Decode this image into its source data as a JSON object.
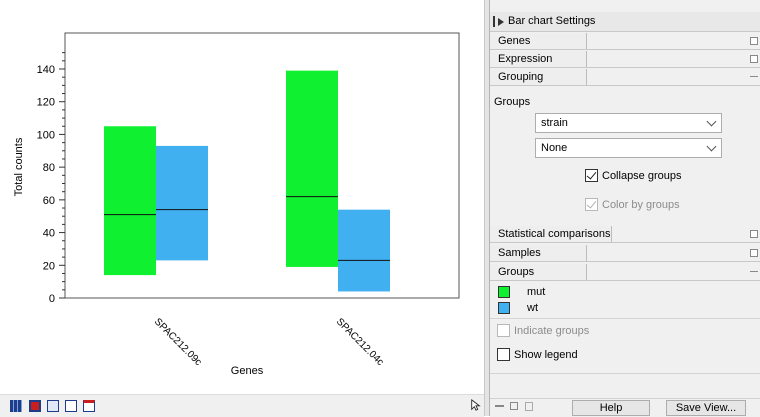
{
  "chart_data": {
    "type": "bar",
    "subtype": "floating-range-with-median",
    "title": "",
    "xlabel": "Genes",
    "ylabel": "Total counts",
    "ylim": [
      0,
      150
    ],
    "yticks": [
      0,
      20,
      40,
      60,
      80,
      100,
      120,
      140
    ],
    "categories": [
      "SPAC212.09c",
      "SPAC212.04c"
    ],
    "series": [
      {
        "name": "mut",
        "color": "#0ff030",
        "low": [
          14,
          19
        ],
        "high": [
          105,
          139
        ],
        "median": [
          51,
          62
        ]
      },
      {
        "name": "wt",
        "color": "#40b0f0",
        "low": [
          23,
          4
        ],
        "high": [
          93,
          54
        ],
        "median": [
          54,
          23
        ]
      }
    ],
    "grid": false,
    "legend": "none"
  },
  "panel": {
    "title": "Bar chart Settings",
    "sections": {
      "genes": "Genes",
      "expression_values": "Expression values",
      "grouping": "Grouping",
      "statistical_comparisons": "Statistical comparisons",
      "samples": "Samples",
      "groups": "Groups"
    },
    "grouping": {
      "groups_label": "Groups",
      "combo1": "strain",
      "combo2": "None",
      "collapse_groups": "Collapse groups",
      "color_by_groups": "Color by groups"
    },
    "groups_list": [
      {
        "name": "mut",
        "color": "#0ff030"
      },
      {
        "name": "wt",
        "color": "#40b0f0"
      }
    ],
    "indicate_groups": "Indicate groups",
    "show_legend": "Show legend",
    "help_button": "Help",
    "save_view_button": "Save View..."
  }
}
